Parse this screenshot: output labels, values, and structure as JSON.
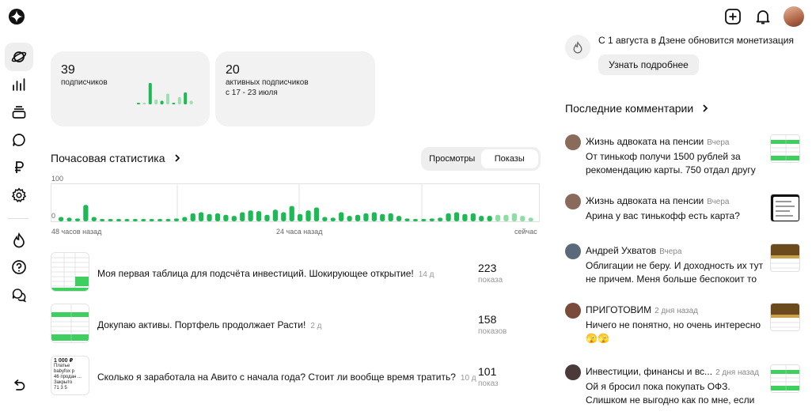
{
  "colors": {
    "accent_green": "#1db954",
    "light_green": "#8fdca5"
  },
  "sidebar": {
    "logo": "zen-star-icon",
    "items": [
      {
        "icon": "planet-icon",
        "active": true
      },
      {
        "icon": "stats-icon"
      },
      {
        "icon": "layers-icon"
      },
      {
        "icon": "chat-bubble-icon"
      },
      {
        "icon": "ruble-icon"
      },
      {
        "icon": "settings-icon"
      },
      {
        "icon": "flame-icon"
      },
      {
        "icon": "help-icon"
      },
      {
        "icon": "messages-icon"
      },
      {
        "icon": "back-icon"
      }
    ]
  },
  "header": {
    "icons": [
      "add-post-icon",
      "bell-icon",
      "avatar"
    ]
  },
  "cards": [
    {
      "num": "39",
      "label": "подписчиков",
      "bars": [
        0.05,
        0.05,
        0.9,
        0.2,
        0.15,
        0.45,
        0.05,
        0.3,
        0.5,
        0.15
      ]
    },
    {
      "num": "20",
      "label": "активных подписчиков",
      "sublabel": "с 17 - 23 июля"
    }
  ],
  "hourly": {
    "title": "Почасовая статистика",
    "tabs": [
      "Просмотры",
      "Показы"
    ],
    "active_tab": "Показы",
    "chart_data": {
      "type": "bar",
      "y_ticks": [
        "100",
        "0"
      ],
      "x_labels": [
        "48 часов назад",
        "24 часа назад",
        "сейчас"
      ],
      "ylim": [
        0,
        100
      ],
      "values": [
        12,
        10,
        8,
        45,
        12,
        6,
        6,
        6,
        6,
        6,
        5,
        6,
        6,
        6,
        8,
        12,
        22,
        25,
        20,
        22,
        18,
        15,
        25,
        30,
        28,
        18,
        32,
        25,
        42,
        20,
        30,
        38,
        12,
        10,
        25,
        15,
        18,
        22,
        25,
        20,
        22,
        15,
        8,
        5,
        5,
        8,
        10,
        22,
        25,
        20,
        22,
        15,
        15,
        18,
        18,
        22,
        15,
        10
      ],
      "light_from_index": 53
    }
  },
  "posts": [
    {
      "title": "Моя первая таблица для подсчёта инвестиций. Шокирующее открытие!",
      "age": "14 д",
      "views": "223",
      "views_label": "показа"
    },
    {
      "title": "Докупаю активы. Портфель продолжает Расти!",
      "age": "2 д",
      "views": "158",
      "views_label": "показов"
    },
    {
      "title": "Сколько я заработала на Авито с начала года? Стоит ли вообще время тратить?",
      "age": "10 д",
      "views": "101",
      "views_label": "показ",
      "thumb_text": [
        "1 000 ₽",
        "Платье babyfox р",
        "46 продан ...",
        "Закрыто",
        "71   3   5"
      ]
    }
  ],
  "notice": {
    "text": "С 1 августа в Дзене обновится монетизация",
    "button": "Узнать подробнее"
  },
  "comments_title": "Последние комментарии",
  "comments": [
    {
      "author": "Жизнь адвоката на пенсии",
      "when": "Вчера",
      "text": "От тинькоф получи 1500 рублей за рекомендацию карты. 750 отдал другу",
      "ava": "#8a6a5a",
      "thumb": "sheet"
    },
    {
      "author": "Жизнь адвоката на пенсии",
      "when": "Вчера",
      "text": "Арина у вас тинькофф есть карта?",
      "ava": "#8a6a5a",
      "thumb": "phone"
    },
    {
      "author": "Андрей Ухватов",
      "when": "Вчера",
      "text": "Облигации не беру. И доходность их тут не причем. Меня больше беспокоит то",
      "ava": "#5a6a7a",
      "thumb": "gold"
    },
    {
      "author": "ПРИГОТОВИМ",
      "when": "2 дня назад",
      "text": "Ничего не понятно, но очень интересно 🫣🫣",
      "ava": "#7a4a3a",
      "thumb": "gold"
    },
    {
      "author": "Инвестиции, финансы и вс...",
      "when": "2 дня назад",
      "text": "Ой я бросил пока покупать ОФЗ. Слишком не выгодно как по мне, если",
      "ava": "#4a3a3a",
      "thumb": "sheet"
    }
  ]
}
